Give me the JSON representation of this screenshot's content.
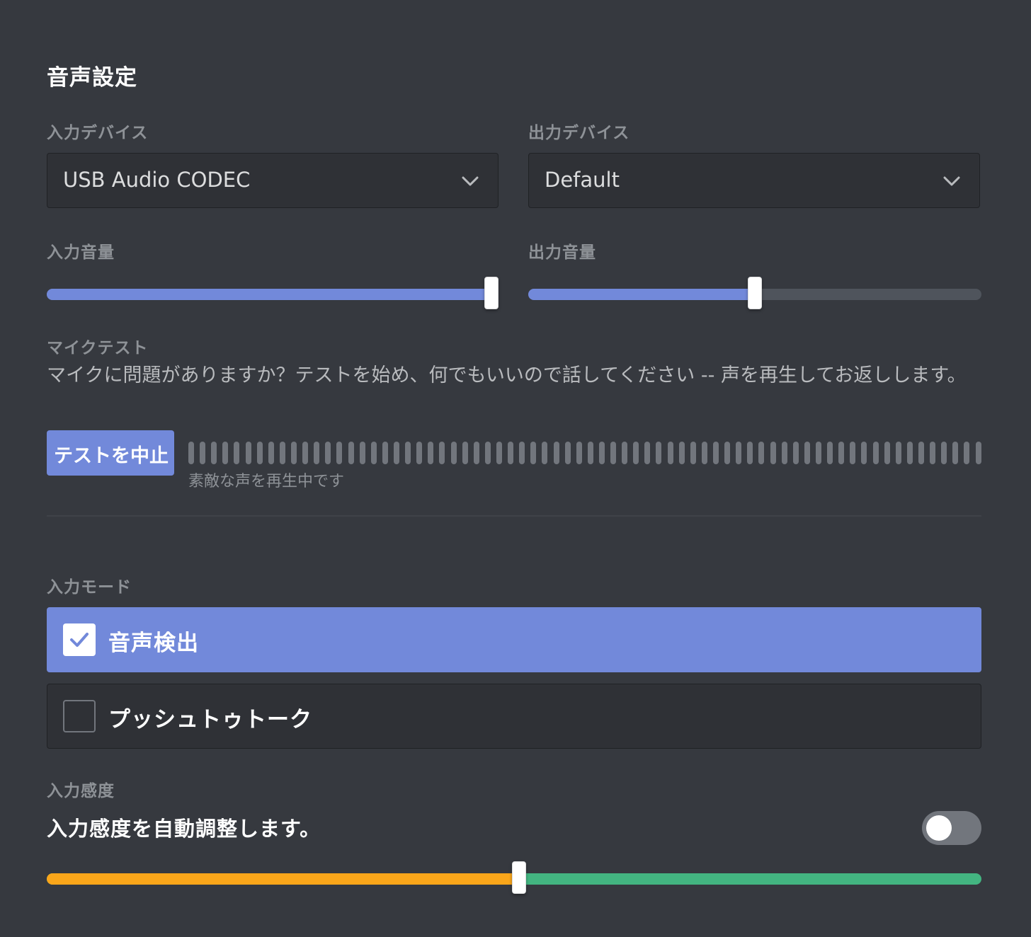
{
  "header": {
    "title": "音声設定"
  },
  "input_device": {
    "label": "入力デバイス",
    "value": "USB Audio CODEC"
  },
  "output_device": {
    "label": "出力デバイス",
    "value": "Default"
  },
  "input_volume": {
    "label": "入力音量",
    "level": 1.0
  },
  "output_volume": {
    "label": "出力音量",
    "level": 0.5
  },
  "mic_test": {
    "label": "マイクテスト",
    "description": "マイクに問題がありますか？テストを始め、何でもいいので話してください -- 声を再生してお返しします。",
    "button_label": "テストを中止",
    "meter_caption": "素敵な声を再生中です",
    "meter_level": 0.0
  },
  "input_mode": {
    "label": "入力モード",
    "options": [
      {
        "label": "音声検出",
        "selected": true
      },
      {
        "label": "プッシュトゥトーク",
        "selected": false
      }
    ]
  },
  "sensitivity": {
    "label": "入力感度",
    "auto_label": "入力感度を自動調整します。",
    "auto_enabled": false,
    "threshold": 0.505
  },
  "colors": {
    "background": "#36393f",
    "accent": "#7289da",
    "sensitivity_low": "#faa61a",
    "sensitivity_high": "#43b581"
  }
}
